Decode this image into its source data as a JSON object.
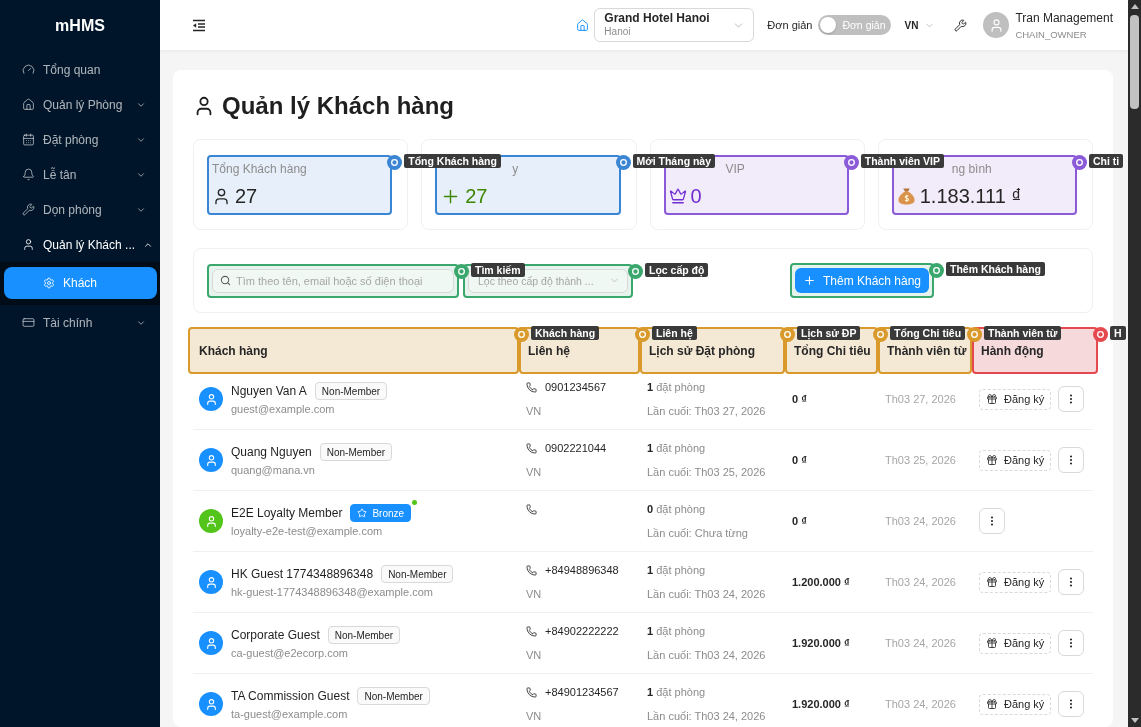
{
  "sidebar": {
    "logo": "mHMS",
    "items": [
      {
        "kind": "link",
        "label": "Tổng quan",
        "selected": false
      },
      {
        "kind": "submenu",
        "label": "Quản lý Phòng",
        "selected": false,
        "expanded": false
      },
      {
        "kind": "submenu",
        "label": "Đặt phòng",
        "selected": false,
        "expanded": false
      },
      {
        "kind": "submenu",
        "label": "Lễ tân",
        "selected": false,
        "expanded": false
      },
      {
        "kind": "submenu",
        "label": "Dọn phòng",
        "selected": false,
        "expanded": false
      },
      {
        "kind": "submenu",
        "label": "Quản lý Khách ...",
        "selected": true,
        "expanded": true,
        "children": [
          {
            "label": "Khách",
            "selected": true
          }
        ]
      },
      {
        "kind": "submenu",
        "label": "Tài chính",
        "selected": false,
        "expanded": false
      }
    ]
  },
  "header": {
    "hotel": {
      "name": "Grand Hotel Hanoi",
      "city": "Hanoi"
    },
    "mode": {
      "label": "Đơn giản",
      "switch_text": "Đơn giản",
      "on": false
    },
    "language": "VN",
    "user": {
      "name": "Tran Management",
      "role": "CHAIN_OWNER"
    }
  },
  "page": {
    "title": "Quản lý Khách hàng",
    "stats": [
      {
        "label": "Tổng Khách hàng",
        "value": "27",
        "color": "#262626",
        "annotation": {
          "tag": "Tổng Khách hàng",
          "color": "#3a86d4"
        }
      },
      {
        "label": "y",
        "value": "27",
        "color": "#3f8600",
        "annotation": {
          "tag": "Mới Tháng này",
          "color": "#3a86d4"
        }
      },
      {
        "label": "VIP",
        "value": "0",
        "color": "#722ed1",
        "annotation": {
          "tag": "Thành viên VIP",
          "color": "#8a5ad8"
        }
      },
      {
        "label": "ng bình",
        "value": "1.183.111 ₫",
        "color": "#262626",
        "annotation": {
          "tag": "Chi ti",
          "color": "#8a5ad8"
        }
      }
    ],
    "filters": {
      "search": {
        "placeholder": "Tìm theo tên, email hoặc số điện thoại",
        "annotation": {
          "tag": "Tìm kiếm",
          "color": "#3aa76d"
        }
      },
      "level_select": {
        "placeholder": "Lọc theo cấp độ thành ...",
        "annotation": {
          "tag": "Lọc cấp độ",
          "color": "#3aa76d"
        }
      },
      "add_button": {
        "label": "Thêm Khách hàng",
        "annotation": {
          "tag": "Thêm Khách hàng",
          "color": "#3aa76d"
        }
      }
    },
    "table": {
      "columns": [
        {
          "label": "Khách hàng",
          "annotation": {
            "tag": "Khách hàng",
            "color": "#d99a2b"
          }
        },
        {
          "label": "Liên hệ",
          "annotation": {
            "tag": "Liên hệ",
            "color": "#d99a2b"
          }
        },
        {
          "label": "Lịch sử Đặt phòng",
          "annotation": {
            "tag": "Lịch sử ĐP",
            "color": "#d99a2b"
          }
        },
        {
          "label": "Tổng Chi tiêu",
          "annotation": {
            "tag": "Tổng Chi tiêu",
            "color": "#d99a2b"
          }
        },
        {
          "label": "Thành viên từ",
          "annotation": {
            "tag": "Thành viên từ",
            "color": "#d99a2b"
          }
        },
        {
          "label": "Hành động",
          "annotation": {
            "tag": "H",
            "color": "#e5484d"
          }
        }
      ],
      "rows": [
        {
          "avatar": {
            "color": "#1890ff"
          },
          "name": "Nguyen Van A",
          "tier": {
            "kind": "member",
            "label": "Non-Member"
          },
          "email": "guest@example.com",
          "phone": "0901234567",
          "country": "VN",
          "bookings": "**1** đặt phòng",
          "last_booking": "Lần cuối: Th03 27, 2026",
          "total": "0 ₫",
          "member_since": "Th03 27, 2026",
          "enroll_label": "Đăng ký"
        },
        {
          "avatar": {
            "color": "#1890ff"
          },
          "name": "Quang Nguyen",
          "tier": {
            "kind": "member",
            "label": "Non-Member"
          },
          "email": "quang@mana.vn",
          "phone": "0902221044",
          "country": "VN",
          "bookings": "**1** đặt phòng",
          "last_booking": "Lần cuối: Th03 25, 2026",
          "total": "0 ₫",
          "member_since": "Th03 25, 2026",
          "enroll_label": "Đăng ký"
        },
        {
          "avatar": {
            "color": "#52c41a"
          },
          "name": "E2E Loyalty Member",
          "tier": {
            "kind": "loyalty",
            "label": "Bronze"
          },
          "status_dot": {
            "color": "#52c41a"
          },
          "email": "loyalty-e2e-test@example.com",
          "bookings": "**0** đặt phòng",
          "last_booking": "Lần cuối: Chưa từng",
          "total": "0 ₫",
          "member_since": "Th03 24, 2026"
        },
        {
          "avatar": {
            "color": "#1890ff"
          },
          "name": "HK Guest 1774348896348",
          "tier": {
            "kind": "member",
            "label": "Non-Member"
          },
          "email": "hk-guest-1774348896348@example.com",
          "phone": "+84948896348",
          "country": "VN",
          "bookings": "**1** đặt phòng",
          "last_booking": "Lần cuối: Th03 24, 2026",
          "total": "1.200.000 ₫",
          "member_since": "Th03 24, 2026",
          "enroll_label": "Đăng ký"
        },
        {
          "avatar": {
            "color": "#1890ff"
          },
          "name": "Corporate Guest",
          "tier": {
            "kind": "member",
            "label": "Non-Member"
          },
          "email": "ca-guest@e2ecorp.com",
          "phone": "+84902222222",
          "country": "VN",
          "bookings": "**1** đặt phòng",
          "last_booking": "Lần cuối: Th03 24, 2026",
          "total": "1.920.000 ₫",
          "member_since": "Th03 24, 2026",
          "enroll_label": "Đăng ký"
        },
        {
          "avatar": {
            "color": "#1890ff"
          },
          "name": "TA Commission Guest",
          "tier": {
            "kind": "member",
            "label": "Non-Member"
          },
          "email": "ta-guest@example.com",
          "phone": "+84901234567",
          "country": "VN",
          "bookings": "**1** đặt phòng",
          "last_booking": "Lần cuối: Th03 24, 2026",
          "total": "1.920.000 ₫",
          "member_since": "Th03 24, 2026",
          "enroll_label": "Đăng ký"
        }
      ]
    }
  }
}
